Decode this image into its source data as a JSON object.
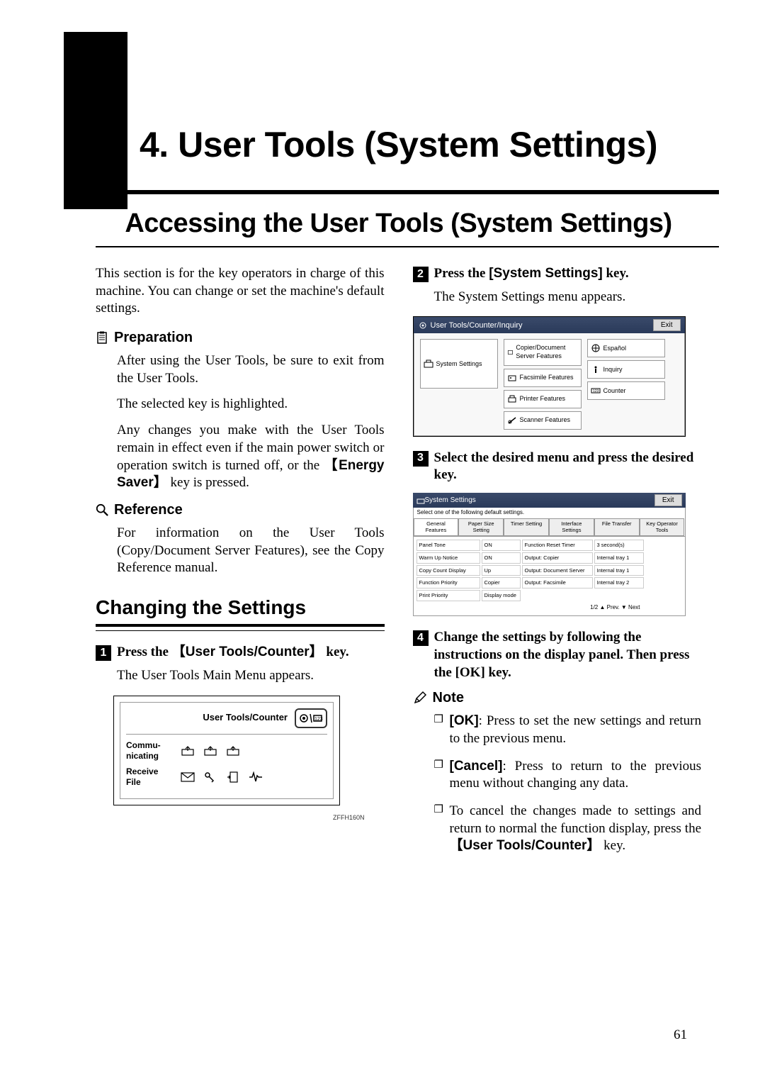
{
  "page_number": "61",
  "chapter": {
    "title": "4. User Tools (System Settings)"
  },
  "section": {
    "title": "Accessing the User Tools (System Settings)"
  },
  "intro": "This section is for the key operators in charge of this machine. You can change or set the machine's default settings.",
  "preparation": {
    "heading": "Preparation",
    "p1": "After using the User Tools, be sure to exit from the User Tools.",
    "p2": "The selected key is highlighted.",
    "p3_pre": "Any changes you make with the User Tools remain in effect even if the main power switch or operation switch is turned off, or the ",
    "p3_key": "Energy Saver",
    "p3_post": " key is pressed."
  },
  "reference": {
    "heading": "Reference",
    "p1": "For information on the User Tools (Copy/Document Server Features), see the Copy Reference manual."
  },
  "subsection": {
    "title": "Changing the Settings"
  },
  "step1": {
    "num": "1",
    "pre": "Press the ",
    "key": "User Tools/Counter",
    "post": " key.",
    "body": "The User Tools Main Menu appears."
  },
  "panel1": {
    "label": "User Tools/Counter",
    "row1": "Commu-\nnicating",
    "row2": "Receive\nFile",
    "code": "ZFFH160N"
  },
  "step2": {
    "num": "2",
    "pre": "Press the ",
    "key": "[System Settings]",
    "post": " key.",
    "body": "The System Settings menu appears."
  },
  "panel2": {
    "title": "User Tools/Counter/Inquiry",
    "exit": "Exit",
    "left": "System Settings",
    "mid": [
      "Copier/Document Server Features",
      "Facsimile Features",
      "Printer Features",
      "Scanner Features"
    ],
    "right": [
      "Español",
      "Inquiry",
      "Counter"
    ]
  },
  "step3": {
    "num": "3",
    "text": "Select the desired menu and press the desired key."
  },
  "panel3": {
    "title": "System Settings",
    "exit": "Exit",
    "hint": "Select one of the following default settings.",
    "tabs": [
      "General Features",
      "Paper Size Setting",
      "Timer Setting",
      "Interface Settings",
      "File Transfer",
      "Key Operator Tools"
    ],
    "rows": [
      [
        "Panel Tone",
        "ON",
        "Function Reset Timer",
        "3 second(s)"
      ],
      [
        "Warm Up Notice",
        "ON",
        "Output: Copier",
        "Internal tray 1"
      ],
      [
        "Copy Count Display",
        "Up",
        "Output: Document Server",
        "Internal tray 1"
      ],
      [
        "Function Priority",
        "Copier",
        "Output: Facsimile",
        "Internal tray 2"
      ],
      [
        "Print Priority",
        "Display mode",
        "",
        ""
      ]
    ],
    "nav": "1/2   ▲ Prev.   ▼ Next"
  },
  "step4": {
    "num": "4",
    "text": "Change the settings by following the instructions on the display panel. Then press the [OK] key."
  },
  "note": {
    "heading": "Note",
    "items": [
      {
        "bold": "[OK]",
        "text": ": Press to set the new settings and return to the previous menu."
      },
      {
        "bold": "[Cancel]",
        "text": ": Press to return to the previous menu without changing any data."
      },
      {
        "bold": "",
        "pre": "To cancel the changes made to settings and return to normal the function display, press the ",
        "key": "User Tools/Counter",
        "post": " key."
      }
    ]
  }
}
